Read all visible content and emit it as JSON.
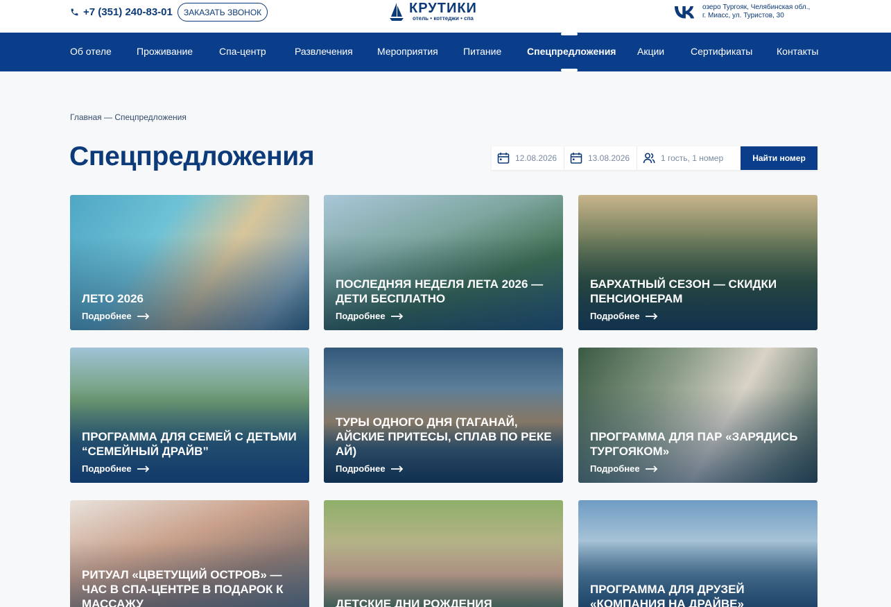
{
  "header": {
    "phone": "+7 (351) 240-83-01",
    "callback_label": "ЗАКАЗАТЬ ЗВОНОК",
    "logo_name": "КРУТИКИ",
    "logo_sub": "отель • коттеджи • спа",
    "vk_label": "VK",
    "address_line1": "озеро Тургояк, Челябинская обл.,",
    "address_line2": "г. Миасс, ул. Туристов, 30"
  },
  "nav": {
    "items": [
      "Об отеле",
      "Проживание",
      "Спа-центр",
      "Развлечения",
      "Мероприятия",
      "Питание",
      "Спецпредложения",
      "Акции",
      "Сертификаты",
      "Контакты"
    ],
    "active_index": 6
  },
  "breadcrumb": "Главная — Спецпредложения",
  "page_title": "Спецпредложения",
  "booking": {
    "checkin": "12.08.2026",
    "checkout": "13.08.2026",
    "guests": "1 гость, 1 номер",
    "find_label": "Найти номер"
  },
  "more_label": "Подробнее",
  "cards": [
    {
      "title": "Лето 2026"
    },
    {
      "title": "Последняя неделя лета 2026 — дети бесплатно"
    },
    {
      "title": "Бархатный сезон — скидки пенсионерам"
    },
    {
      "title": "Программа для семей с детьми “Семейный драйв”"
    },
    {
      "title": "Туры одного дня (Таганай, Айские притесы, сплав по реке Ай)"
    },
    {
      "title": "Программа для пар «Зарядись Тургояком»"
    },
    {
      "title": "Ритуал «Цветущий остров» — час в спа-центре в подарок к массажу"
    },
    {
      "title": "Детские дни рождения"
    },
    {
      "title": "Программа для друзей «Компания на драйве»"
    }
  ],
  "colors": {
    "brand": "#0a3d8a",
    "text": "#0d3a78",
    "background": "#f7f8fa"
  }
}
